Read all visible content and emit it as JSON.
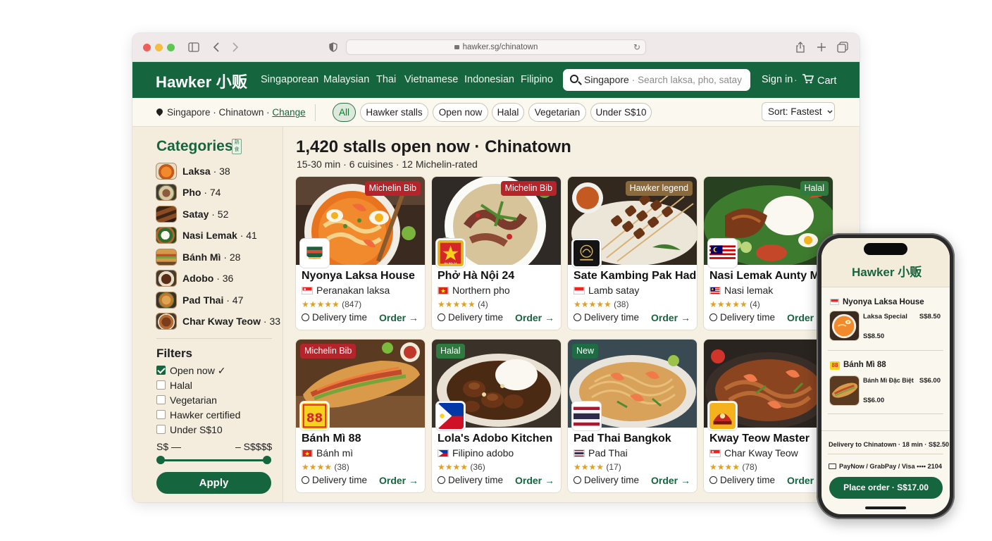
{
  "browser": {
    "url": "hawker.sg/chinatown"
  },
  "site": {
    "logo": "Hawker 小贩",
    "nav": [
      "Singaporean",
      "Malaysian",
      "Thai",
      "Vietnamese",
      "Indonesian",
      "Filipino"
    ],
    "search": {
      "location": "Singapore",
      "sep": "·",
      "placeholder": "Search laksa, pho, satay"
    },
    "sign_in": "Sign in",
    "dot": "·",
    "cart": "Cart",
    "brand_color": "#15653f"
  },
  "filterbar": {
    "location": "Singapore · Chinatown · ",
    "change": "Change",
    "chips": [
      "All",
      "Hawker stalls",
      "Open now",
      "Halal",
      "Vegetarian",
      "Under S$10"
    ],
    "sort": "Sort: Fastest"
  },
  "sidebar": {
    "categories_title": "Categories",
    "categories_badge": "熟 食",
    "categories": [
      {
        "name": "Laksa",
        "count": "· 38"
      },
      {
        "name": "Pho",
        "count": "· 74"
      },
      {
        "name": "Satay",
        "count": "· 52"
      },
      {
        "name": "Nasi Lemak",
        "count": "· 41"
      },
      {
        "name": "Bánh Mì",
        "count": "· 28"
      },
      {
        "name": "Adobo",
        "count": "· 36"
      },
      {
        "name": "Pad Thai",
        "count": "· 47"
      },
      {
        "name": "Char Kway Teow",
        "count": "· 33"
      }
    ],
    "filters_title": "Filters",
    "filters": [
      {
        "label": "Open now ✓",
        "checked": true
      },
      {
        "label": "Halal",
        "checked": false
      },
      {
        "label": "Vegetarian",
        "checked": false
      },
      {
        "label": "Hawker certified",
        "checked": false
      },
      {
        "label": "Under S$10",
        "checked": false
      }
    ],
    "price_min": "S$ —",
    "price_max": "– S$$$$",
    "apply": "Apply"
  },
  "main": {
    "title": "1,420 stalls open now · Chinatown",
    "subtitle": "15-30 min · 6 cuisines · 12 Michelin-rated",
    "delivery_label": "Delivery time",
    "order_label": "Order →",
    "cards": [
      {
        "name": "Nyonya Laksa House",
        "cuisine": "Peranakan laksa",
        "stars": "★★★★★",
        "reviews": "(847)",
        "tag": "Michelin Bib",
        "flag": "sg"
      },
      {
        "name": "Phở Hà Nội 24",
        "cuisine": "Northern pho",
        "stars": "★★★★★",
        "reviews": "(4)",
        "tag": "Michelin Bib",
        "flag": "vn"
      },
      {
        "name": "Sate Kambing Pak Hadi",
        "cuisine": "Lamb satay",
        "stars": "★★★★★",
        "reviews": "(38)",
        "tag": "Hawker legend",
        "flag": "id"
      },
      {
        "name": "Nasi Lemak Aunty Ma",
        "cuisine": "Nasi lemak",
        "stars": "★★★★★",
        "reviews": "(4)",
        "tag": "Halal",
        "flag": "my"
      },
      {
        "name": "Bánh Mì 88",
        "cuisine": "Bánh mì",
        "stars": "★★★★",
        "reviews": "(38)",
        "tag": "Michelin Bib",
        "flag": "vn"
      },
      {
        "name": "Lola's Adobo Kitchen",
        "cuisine": "Filipino adobo",
        "stars": "★★★★",
        "reviews": "(36)",
        "tag": "Halal",
        "flag": "ph"
      },
      {
        "name": "Pad Thai Bangkok",
        "cuisine": "Pad Thai",
        "stars": "★★★★",
        "reviews": "(17)",
        "tag": "New",
        "flag": "th"
      },
      {
        "name": "Kway Teow Master",
        "cuisine": "Char Kway Teow",
        "stars": "★★★★",
        "reviews": "(78)",
        "tag": "",
        "flag": "sg"
      }
    ],
    "logo_text": {
      "c2": "Hà Nội 24",
      "c5": "88"
    }
  },
  "phone": {
    "logo": "Hawker 小贩",
    "stall1": "Nyonya Laksa House",
    "item1": "Laksa Special",
    "item1_price": "S$8.50",
    "item1_sub": "S$8.50",
    "stall2_badge": "88",
    "stall2": "Bánh Mì 88",
    "item2": "Bánh Mì Đặc Biệt",
    "item2_price": "S$6.00",
    "item2_sub": "S$6.00",
    "delivery": "Delivery to Chinatown · 18 min · S$2.50",
    "payment": "PayNow / GrabPay / Visa •••• 2104",
    "place_order": "Place order · S$17.00"
  }
}
